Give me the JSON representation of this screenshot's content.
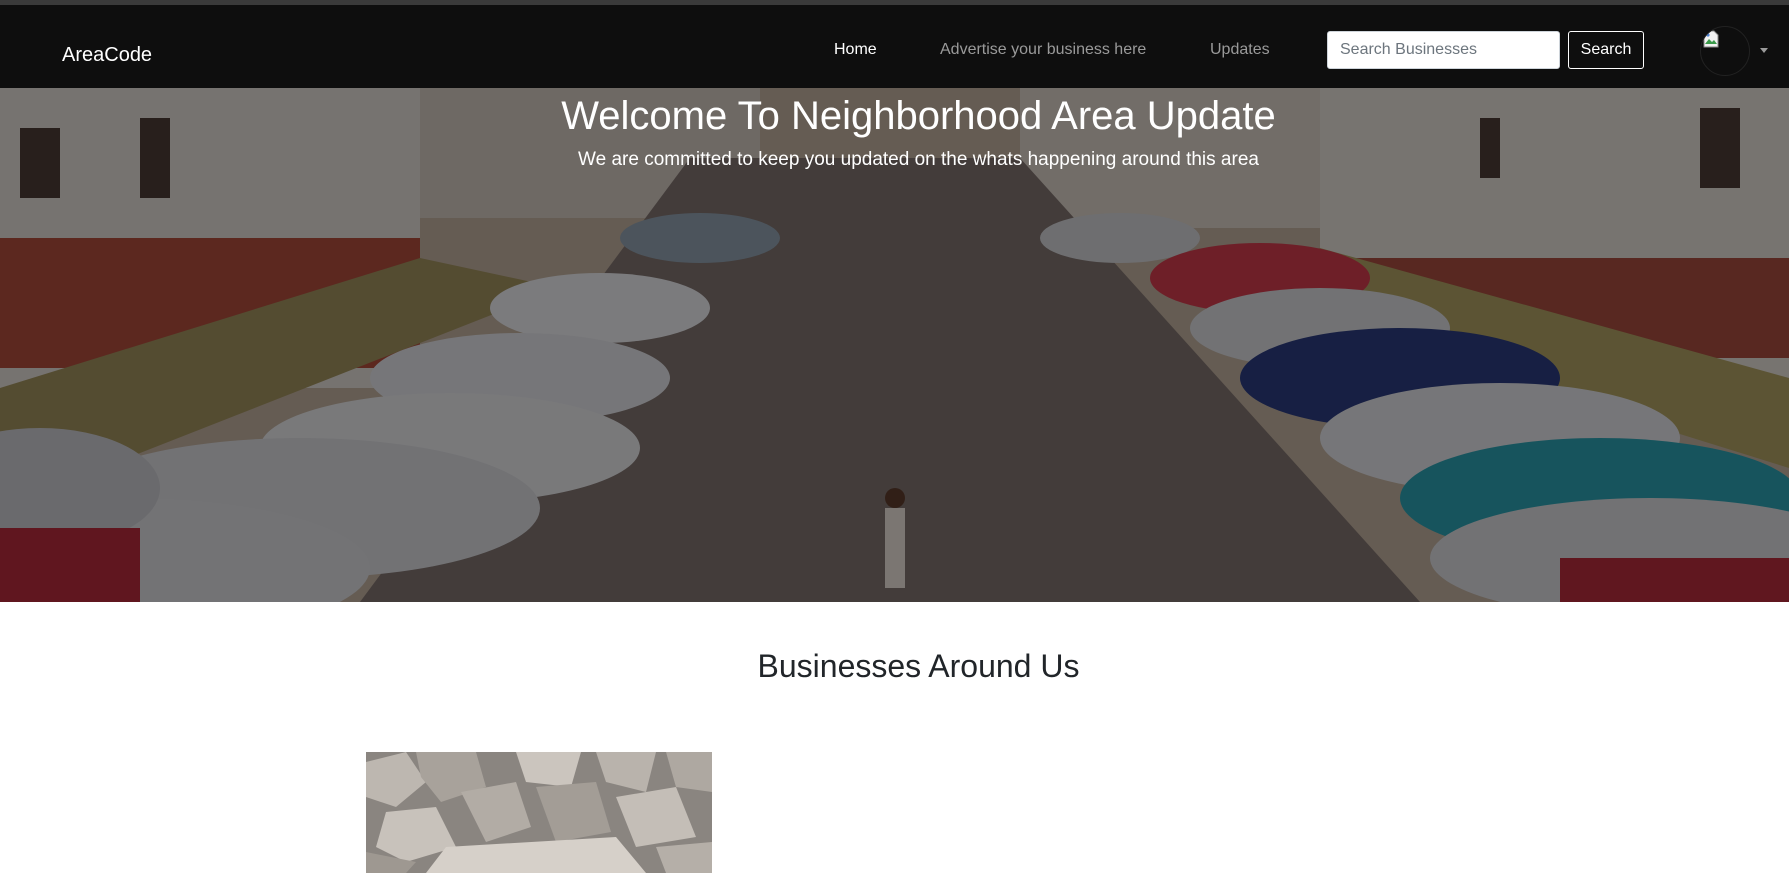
{
  "navbar": {
    "brand": "AreaCode",
    "links": [
      {
        "label": "Home",
        "active": true
      },
      {
        "label": "Advertise your business here",
        "active": false
      },
      {
        "label": "Updates",
        "active": false
      }
    ],
    "search": {
      "placeholder": "Search Businesses",
      "value": "",
      "button_label": "Search"
    },
    "avatar_icon": "user-avatar-icon",
    "dropdown_icon": "caret-down-icon"
  },
  "hero": {
    "title": "Welcome To Neighborhood Area Update",
    "subtitle": "We are committed to keep you updated on the whats happening around this area",
    "background_image": "street-with-parked-cars-photo"
  },
  "businesses": {
    "title": "Businesses Around Us",
    "cards": [
      {
        "image": "quarry-stones-photo"
      }
    ]
  },
  "colors": {
    "navbar_bg": "#0e0e0e",
    "nav_active": "#ffffff",
    "nav_inactive": "#9a9a9a",
    "heading_text": "#212529"
  }
}
